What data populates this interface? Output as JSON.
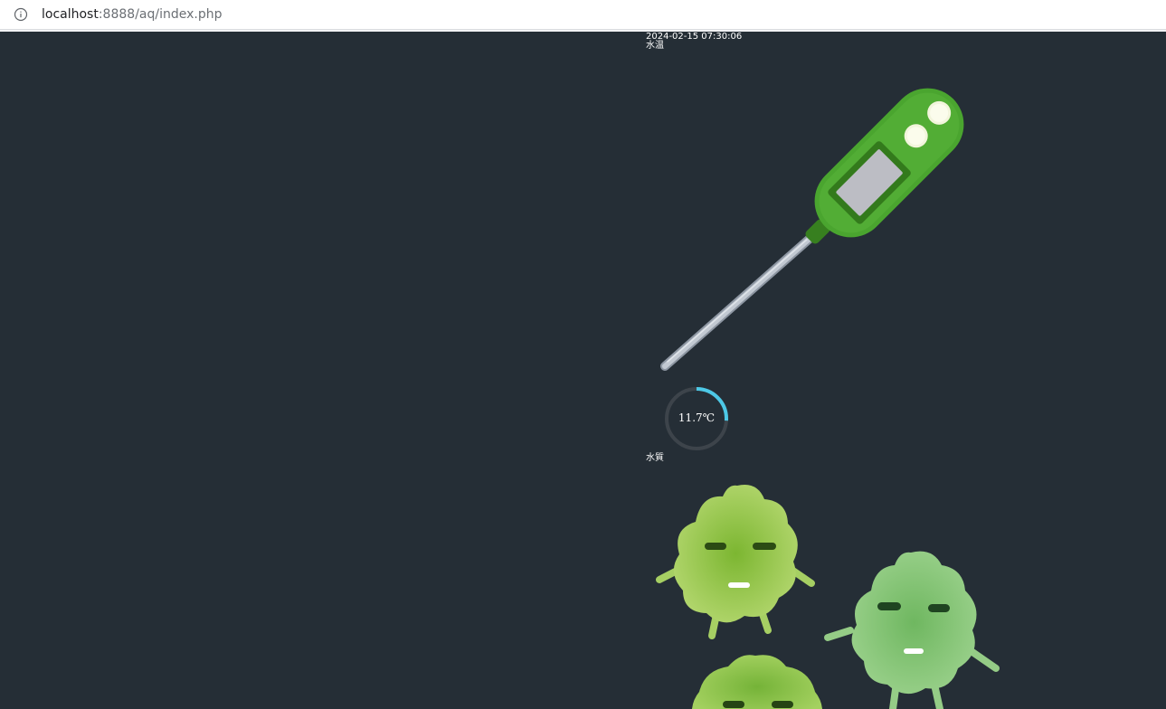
{
  "browser": {
    "url_host": "localhost",
    "url_rest": ":8888/aq/index.php",
    "info_icon": "info-icon"
  },
  "page": {
    "datetime": "2024-02-15 07:30:06",
    "temp_label": "水温",
    "temperature": {
      "value_text": "11.7℃",
      "value": 11.7,
      "gauge_fraction": 0.26
    },
    "quality_label": "水質"
  },
  "colors": {
    "page_bg": "#252e36",
    "gauge_track": "#3d444b",
    "gauge_fill": "#4dc8e6",
    "thermometer_body": "#4aa52f",
    "moss_ball": "#8cc63f"
  }
}
